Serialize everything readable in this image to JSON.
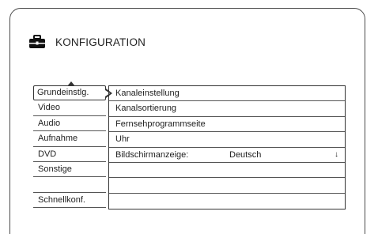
{
  "header": {
    "icon": "toolbox-icon",
    "title": "KONFIGURATION"
  },
  "left_menu": {
    "items": [
      {
        "label": "Grundeinstlg.",
        "selected": true
      },
      {
        "label": "Video"
      },
      {
        "label": "Audio"
      },
      {
        "label": "Aufnahme"
      },
      {
        "label": "DVD"
      },
      {
        "label": "Sonstige"
      },
      {
        "label": ""
      },
      {
        "label": "Schnellkonf."
      }
    ]
  },
  "submenu": {
    "items": [
      {
        "label": "Kanaleinstellung"
      },
      {
        "label": "Kanalsortierung"
      },
      {
        "label": "Fernsehprogrammseite"
      },
      {
        "label": "Uhr"
      },
      {
        "label": "Bildschirmanzeige:",
        "value": "Deutsch",
        "arrow": "down-arrow-icon"
      },
      {
        "label": ""
      },
      {
        "label": ""
      },
      {
        "label": ""
      }
    ]
  }
}
